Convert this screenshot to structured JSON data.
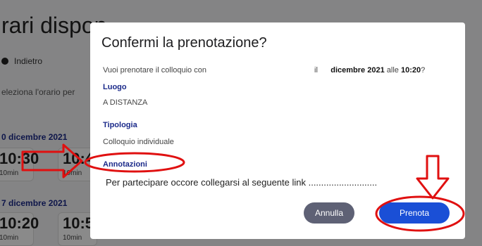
{
  "background": {
    "title": "rari dispon",
    "back_label": "Indietro",
    "instructions": "eleziona l'orario per",
    "groups": [
      {
        "date": "0 dicembre 2021",
        "slots": [
          {
            "time": "10:30",
            "duration": "10min"
          },
          {
            "time": "10:4",
            "duration": "10min"
          }
        ]
      },
      {
        "date": "7 dicembre 2021",
        "slots": [
          {
            "time": "10:20",
            "duration": "10min"
          },
          {
            "time": "10:5",
            "duration": "10min"
          }
        ]
      }
    ]
  },
  "modal": {
    "title": "Confermi la prenotazione?",
    "question_prefix": "Vuoi prenotare il colloquio con",
    "question_il": "il",
    "question_date": "dicembre 2021",
    "question_alle": "alle",
    "question_time": "10:20",
    "question_end": "?",
    "sections": {
      "luogo_label": "Luogo",
      "luogo_value": "A DISTANZA",
      "tipologia_label": "Tipologia",
      "tipologia_value": "Colloquio individuale",
      "annotazioni_label": "Annotazioni",
      "annotazioni_value": "Per partecipare occore collegarsi al seguente link ..........................."
    },
    "buttons": {
      "cancel": "Annulla",
      "confirm": "Prenota"
    }
  },
  "colors": {
    "accent": "#1a4fd6",
    "label": "#1b2a8a",
    "annotation": "#e01010",
    "cancel": "#5e6175"
  },
  "icons": [
    "back-icon",
    "arrow-right-annotation",
    "arrow-down-annotation"
  ]
}
